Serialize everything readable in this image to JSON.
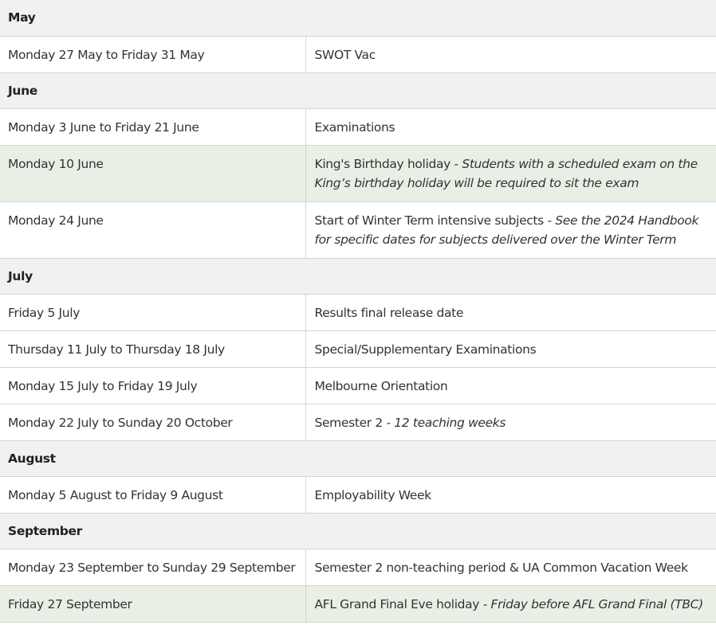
{
  "calendar": {
    "rows": [
      {
        "type": "month",
        "label": "May"
      },
      {
        "type": "event",
        "date": "Monday 27 May to Friday 31 May",
        "event": "SWOT Vac",
        "note": "",
        "highlight": false
      },
      {
        "type": "month",
        "label": "June"
      },
      {
        "type": "event",
        "date": "Monday 3 June to Friday 21 June",
        "event": "Examinations",
        "note": "",
        "highlight": false
      },
      {
        "type": "event",
        "date": "Monday 10 June",
        "event": "King's Birthday holiday",
        "note": "Students with a scheduled exam on the King’s birthday holiday will be required to sit the exam",
        "highlight": true
      },
      {
        "type": "event",
        "date": "Monday 24 June",
        "event": "Start of Winter Term intensive subjects",
        "note": "See the 2024 Handbook for specific dates for subjects delivered over the Winter Term",
        "highlight": false
      },
      {
        "type": "month",
        "label": "July"
      },
      {
        "type": "event",
        "date": "Friday 5 July",
        "event": "Results final release date",
        "note": "",
        "highlight": false
      },
      {
        "type": "event",
        "date": "Thursday 11 July to Thursday 18 July",
        "event": "Special/Supplementary Examinations",
        "note": "",
        "highlight": false
      },
      {
        "type": "event",
        "date": "Monday 15 July to Friday 19 July",
        "event": "Melbourne Orientation",
        "note": "",
        "highlight": false
      },
      {
        "type": "event",
        "date": "Monday 22 July to Sunday 20 October",
        "event": "Semester 2",
        "note": "12 teaching weeks",
        "highlight": false
      },
      {
        "type": "month",
        "label": "August"
      },
      {
        "type": "event",
        "date": "Monday 5 August to Friday 9 August",
        "event": "Employability Week",
        "note": "",
        "highlight": false
      },
      {
        "type": "month",
        "label": "September"
      },
      {
        "type": "event",
        "date": "Monday 23 September to Sunday 29 September",
        "event": "Semester 2 non-teaching period & UA Common Vacation Week",
        "note": "",
        "highlight": false
      },
      {
        "type": "event",
        "date": "Friday 27 September",
        "event": "AFL Grand Final Eve holiday",
        "note": "Friday before AFL Grand Final (TBC)",
        "highlight": true
      }
    ],
    "separator": " - "
  }
}
